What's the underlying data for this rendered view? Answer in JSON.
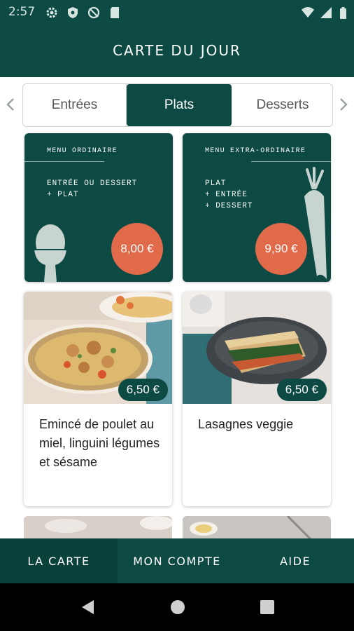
{
  "status_bar": {
    "time": "2:57",
    "left_icons": [
      "settings-icon",
      "shield-icon",
      "no-sync-icon",
      "sd-card-icon"
    ],
    "right_icons": [
      "wifi-icon",
      "signal-icon",
      "battery-icon"
    ]
  },
  "app_bar": {
    "title": "CARTE DU JOUR"
  },
  "tabs": {
    "items": [
      {
        "label": "Entrées",
        "selected": false
      },
      {
        "label": "Plats",
        "selected": true
      },
      {
        "label": "Desserts",
        "selected": false
      }
    ]
  },
  "menu_cards": [
    {
      "title": "MENU ORDINAIRE",
      "description": "ENTRÉE OU DESSERT\n+ PLAT",
      "price": "8,00 €",
      "illustration": "egg-cup-icon"
    },
    {
      "title": "MENU EXTRA-ORDINAIRE",
      "description": "PLAT\n+ ENTRÉE\n+ DESSERT",
      "price": "9,90 €",
      "illustration": "carrot-icon"
    }
  ],
  "dishes": [
    {
      "name": "Emincé de poulet au miel, linguini légumes et sésame",
      "price": "6,50 €"
    },
    {
      "name": "Lasagnes veggie",
      "price": "6,50 €"
    }
  ],
  "bottom_nav": {
    "items": [
      "LA CARTE",
      "MON COMPTE",
      "AIDE"
    ],
    "active": "LA CARTE"
  },
  "colors": {
    "primary": "#0d4a43",
    "accent": "#e16a4b"
  },
  "system_nav": {
    "icons": [
      "back-icon",
      "home-icon",
      "recents-icon"
    ]
  }
}
